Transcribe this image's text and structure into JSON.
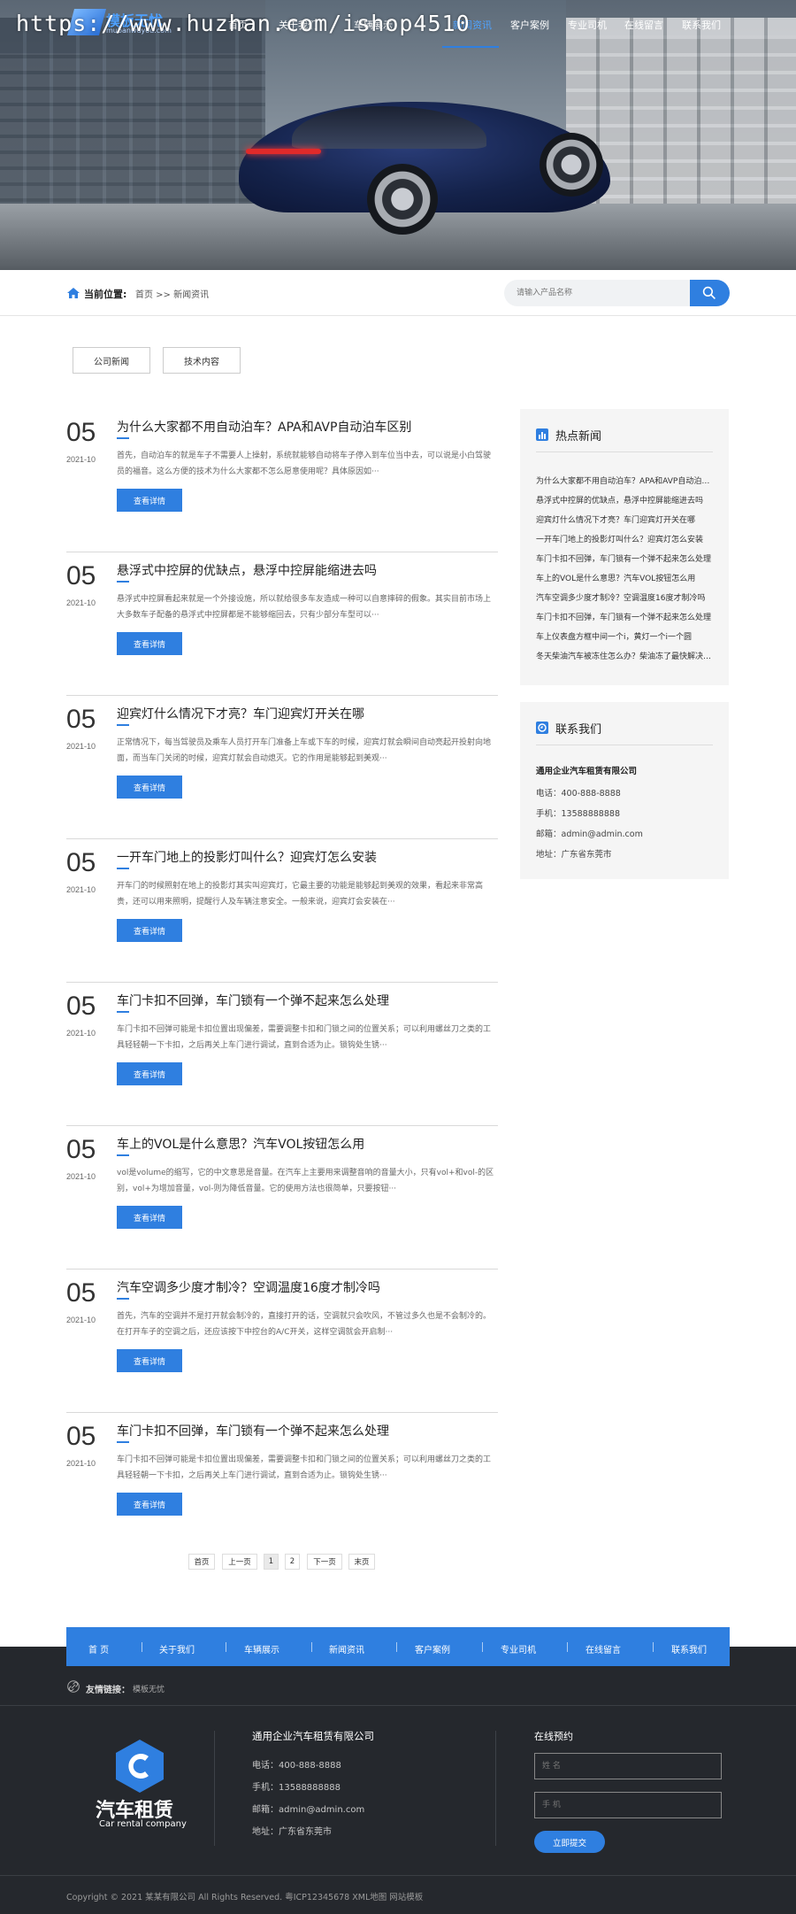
{
  "watermark": "https://www.huzhan.com/ishop4510",
  "logo": {
    "name": "模板无忧",
    "sub": "mubanwuyou.com"
  },
  "nav": {
    "items": [
      "首页",
      "关于我们",
      "车辆展示",
      "新闻资讯",
      "客户案例",
      "专业司机",
      "在线留言",
      "联系我们"
    ],
    "active_index": 3
  },
  "breadcrumb": {
    "label": "当前位置:",
    "path": "首页 >> 新闻资讯"
  },
  "search": {
    "placeholder": "请输入产品名称"
  },
  "categories": [
    "公司新闻",
    "技术内容"
  ],
  "articles": [
    {
      "day": "05",
      "ym": "2021-10",
      "title": "为什么大家都不用自动泊车？APA和AVP自动泊车区别",
      "summary": "首先，自动泊车的就是车子不需要人上操射，系统就能够自动将车子停入到车位当中去，可以说是小白驾驶员的福音。这么方便的技术为什么大家都不怎么愿意使用呢？具体原因如···",
      "more": "查看详情"
    },
    {
      "day": "05",
      "ym": "2021-10",
      "title": "悬浮式中控屏的优缺点，悬浮中控屏能缩进去吗",
      "summary": "悬浮式中控屏看起来就是一个外接设施，所以就给很多车友造成一种可以自意摔碎的假象。其实目前市场上大多数车子配备的悬浮式中控屏都是不能够缩回去，只有少部分车型可以···",
      "more": "查看详情"
    },
    {
      "day": "05",
      "ym": "2021-10",
      "title": "迎宾灯什么情况下才亮？车门迎宾灯开关在哪",
      "summary": "正常情况下，每当驾驶员及乘车人员打开车门准备上车或下车的时候，迎宾灯就会瞬间自动亮起开投射向地面，而当车门关闭的时候，迎宾灯就会自动熄灭。它的作用是能够起到美观···",
      "more": "查看详情"
    },
    {
      "day": "05",
      "ym": "2021-10",
      "title": "一开车门地上的投影灯叫什么？迎宾灯怎么安装",
      "summary": "开车门的时候照射在地上的投影灯其实叫迎宾灯，它最主要的功能是能够起到美观的效果，看起来非常高贵，还可以用来照明，提醒行人及车辆注意安全。一般来说，迎宾灯会安装在···",
      "more": "查看详情"
    },
    {
      "day": "05",
      "ym": "2021-10",
      "title": "车门卡扣不回弹，车门锁有一个弹不起来怎么处理",
      "summary": "车门卡扣不回弹可能是卡扣位置出现偏差，需要调整卡扣和门锁之间的位置关系；可以利用螺丝刀之类的工具轻轻朝一下卡扣，之后再关上车门进行调试，直到合适为止。锁钩处生锈···",
      "more": "查看详情"
    },
    {
      "day": "05",
      "ym": "2021-10",
      "title": "车上的VOL是什么意思？汽车VOL按钮怎么用",
      "summary": "vol是volume的缩写，它的中文意思是音量。在汽车上主要用来调整音响的音量大小，只有vol+和vol-的区别，vol+为增加音量，vol-则为降低音量。它的使用方法也很简单，只要按钮···",
      "more": "查看详情"
    },
    {
      "day": "05",
      "ym": "2021-10",
      "title": "汽车空调多少度才制冷？空调温度16度才制冷吗",
      "summary": "首先，汽车的空调并不是打开就会制冷的，直接打开的话，空调就只会吹风，不管过多久也是不会制冷的。在打开车子的空调之后，还应该按下中控台的A/C开关，这样空调就会开启制···",
      "more": "查看详情"
    },
    {
      "day": "05",
      "ym": "2021-10",
      "title": "车门卡扣不回弹，车门锁有一个弹不起来怎么处理",
      "summary": "车门卡扣不回弹可能是卡扣位置出现偏差，需要调整卡扣和门锁之间的位置关系；可以利用螺丝刀之类的工具轻轻朝一下卡扣，之后再关上车门进行调试，直到合适为止。锁钩处生锈···",
      "more": "查看详情"
    }
  ],
  "pagination": [
    "首页",
    "上一页",
    "1",
    "2",
    "下一页",
    "末页"
  ],
  "hot": {
    "title": "热点新闻",
    "items": [
      "为什么大家都不用自动泊车？APA和AVP自动泊车区别",
      "悬浮式中控屏的优缺点，悬浮中控屏能缩进去吗",
      "迎宾灯什么情况下才亮？车门迎宾灯开关在哪",
      "一开车门地上的投影灯叫什么？迎宾灯怎么安装",
      "车门卡扣不回弹，车门锁有一个弹不起来怎么处理",
      "车上的VOL是什么意思？汽车VOL按钮怎么用",
      "汽车空调多少度才制冷？空调温度16度才制冷吗",
      "车门卡扣不回弹，车门锁有一个弹不起来怎么处理",
      "车上仪表盘方框中间一个i，黄灯一个i一个圆",
      "冬天柴油汽车被冻住怎么办？柴油冻了最快解决办法"
    ]
  },
  "contact": {
    "title": "联系我们",
    "company": "通用企业汽车租赁有限公司",
    "phone": "电话：400-888-8888",
    "mobile": "手机：13588888888",
    "email": "邮箱：admin@admin.com",
    "address": "地址：广东省东莞市"
  },
  "footer_nav": [
    "首 页",
    "关于我们",
    "车辆展示",
    "新闻资讯",
    "客户案例",
    "专业司机",
    "在线留言",
    "联系我们"
  ],
  "friend_links": {
    "label": "友情链接：",
    "value": "模板无忧"
  },
  "footer": {
    "brand_cn": "汽车租赁",
    "brand_en": "Car rental company",
    "company": "通用企业汽车租赁有限公司",
    "phone": "电话：400-888-8888",
    "mobile": "手机：13588888888",
    "email": "邮箱：admin@admin.com",
    "address": "地址：广东省东莞市",
    "msg_title": "在线预约",
    "name_placeholder": "姓 名",
    "phone_placeholder": "手 机",
    "submit": "立即提交",
    "copyright": "Copyright © 2021 某某有限公司 All Rights Reserved.  粤ICP12345678   XML地图   网站模板"
  }
}
